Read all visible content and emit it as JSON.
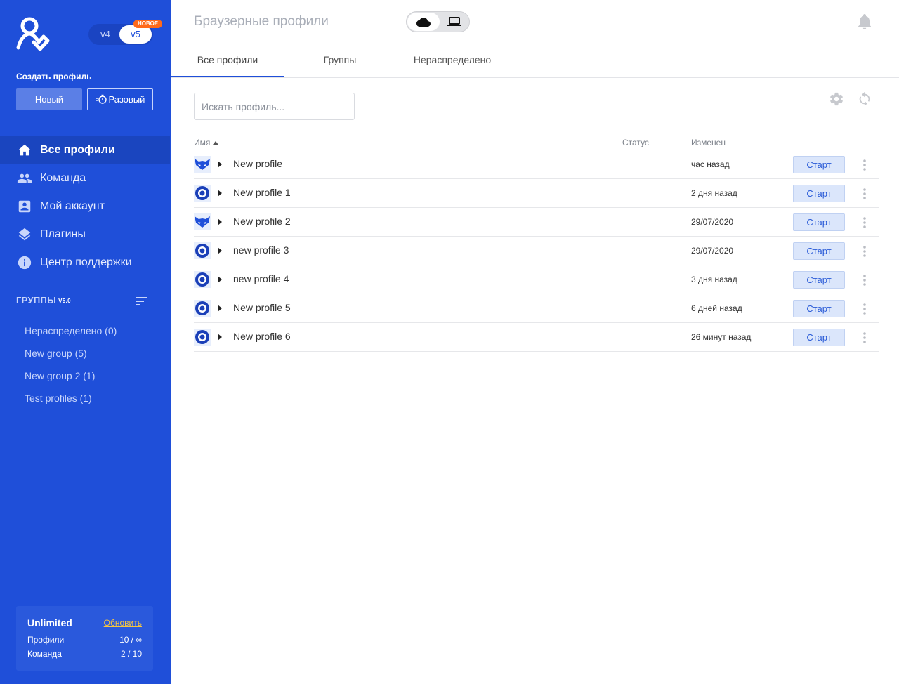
{
  "sidebar": {
    "versions": {
      "v4": "v4",
      "v5": "v5",
      "badge": "НОВОЕ"
    },
    "create_label": "Создать профиль",
    "btn_new": "Новый",
    "btn_once": "Разовый",
    "nav": [
      {
        "label": "Все профили",
        "icon": "home-icon",
        "active": true
      },
      {
        "label": "Команда",
        "icon": "team-icon",
        "active": false
      },
      {
        "label": "Мой аккаунт",
        "icon": "account-icon",
        "active": false
      },
      {
        "label": "Плагины",
        "icon": "layers-icon",
        "active": false
      },
      {
        "label": "Центр поддержки",
        "icon": "info-icon",
        "active": false
      }
    ],
    "groups_title": "ГРУППЫ",
    "groups_version": "V5.0",
    "groups": [
      {
        "label": "Нераспределено  (0)"
      },
      {
        "label": "New group  (5)"
      },
      {
        "label": "New group 2  (1)"
      },
      {
        "label": "Test profiles  (1)"
      }
    ],
    "plan": {
      "name": "Unlimited",
      "upgrade": "Обновить",
      "profiles_label": "Профили",
      "profiles_value": "10 / ∞",
      "team_label": "Команда",
      "team_value": "2 / 10"
    }
  },
  "header": {
    "title": "Браузерные профили",
    "mode": {
      "selected": "cloud",
      "options": [
        "cloud",
        "local"
      ]
    }
  },
  "tabs": [
    {
      "label": "Все профили",
      "active": true
    },
    {
      "label": "Группы",
      "active": false
    },
    {
      "label": "Нераспределено",
      "active": false
    }
  ],
  "search": {
    "placeholder": "Искать профиль...",
    "value": ""
  },
  "table": {
    "columns": {
      "name": "Имя",
      "status": "Статус",
      "modified": "Изменен"
    },
    "start_label": "Старт",
    "rows": [
      {
        "name": "New profile",
        "browser": "fox",
        "status": "",
        "modified": "час назад"
      },
      {
        "name": "New profile 1",
        "browser": "circle",
        "status": "",
        "modified": "2 дня назад"
      },
      {
        "name": "New profile 2",
        "browser": "fox",
        "status": "",
        "modified": "29/07/2020"
      },
      {
        "name": "new profile 3",
        "browser": "circle",
        "status": "",
        "modified": "29/07/2020"
      },
      {
        "name": "new profile 4",
        "browser": "circle",
        "status": "",
        "modified": "3 дня назад"
      },
      {
        "name": "New profile 5",
        "browser": "circle",
        "status": "",
        "modified": "6 дней назад"
      },
      {
        "name": "New profile 6",
        "browser": "circle",
        "status": "",
        "modified": "26 минут назад"
      }
    ]
  },
  "colors": {
    "sidebar": "#1f4fd9",
    "accent": "#1f4fd9",
    "badge": "#ff6a1a",
    "upgrade": "#f4c542"
  }
}
